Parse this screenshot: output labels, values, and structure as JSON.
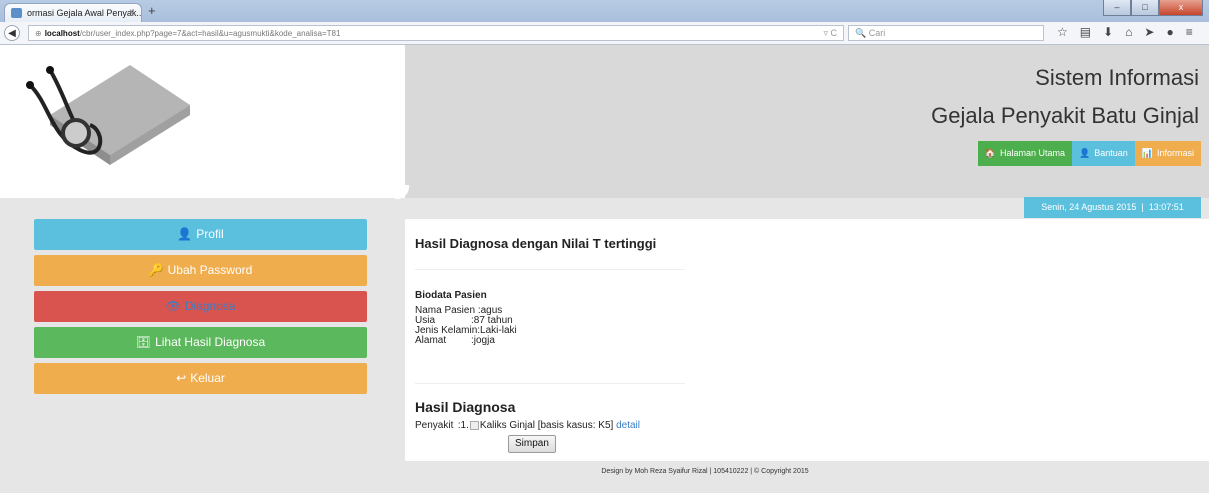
{
  "browser": {
    "tab_title": "ormasi Gejala Awal Penyak...",
    "tab_close": "×",
    "new_tab": "+",
    "url_host": "localhost",
    "url_path": "/cbr/user_index.php?page=7&act=hasil&u=agusmukti&kode_analisa=T81",
    "search_placeholder": "Cari",
    "win_min": "–",
    "win_max": "□",
    "win_close": "x"
  },
  "header": {
    "title_line1": "Sistem Informasi",
    "title_line2": "Gejala Penyakit Batu Ginjal",
    "nav": {
      "home": "Halaman Utama",
      "help": "Bantuan",
      "info": "Informasi"
    }
  },
  "date": {
    "day": "Senin, 24 Agustus 2015",
    "sep": "|",
    "time": "13:07:51"
  },
  "sidebar": {
    "items": [
      {
        "label": "Profil"
      },
      {
        "label": "Ubah Password"
      },
      {
        "label": "Diagnosa"
      },
      {
        "label": "Lihat Hasil Diagnosa"
      },
      {
        "label": "Keluar"
      }
    ]
  },
  "content": {
    "heading": "Hasil Diagnosa dengan Nilai T tertinggi",
    "bio_heading": "Biodata Pasien",
    "bio": {
      "nama_label": "Nama Pasien",
      "nama_value": ":agus",
      "usia_label": "Usia",
      "usia_value": ":87 tahun",
      "jk_label": "Jenis Kelamin",
      "jk_value": ":Laki-laki",
      "alamat_label": "Alamat",
      "alamat_value": ":jogja"
    },
    "hasil_heading": "Hasil Diagnosa",
    "penyakit_label": "Penyakit",
    "penyakit_prefix": ":1.",
    "penyakit_value": "Kaliks Ginjal [basis kasus: K5]",
    "detail_link": "detail",
    "save_button": "Simpan"
  },
  "footer": {
    "text": "Design by Moh Reza Syaifur Rizal | 105410222 | © Copyright 2015"
  }
}
